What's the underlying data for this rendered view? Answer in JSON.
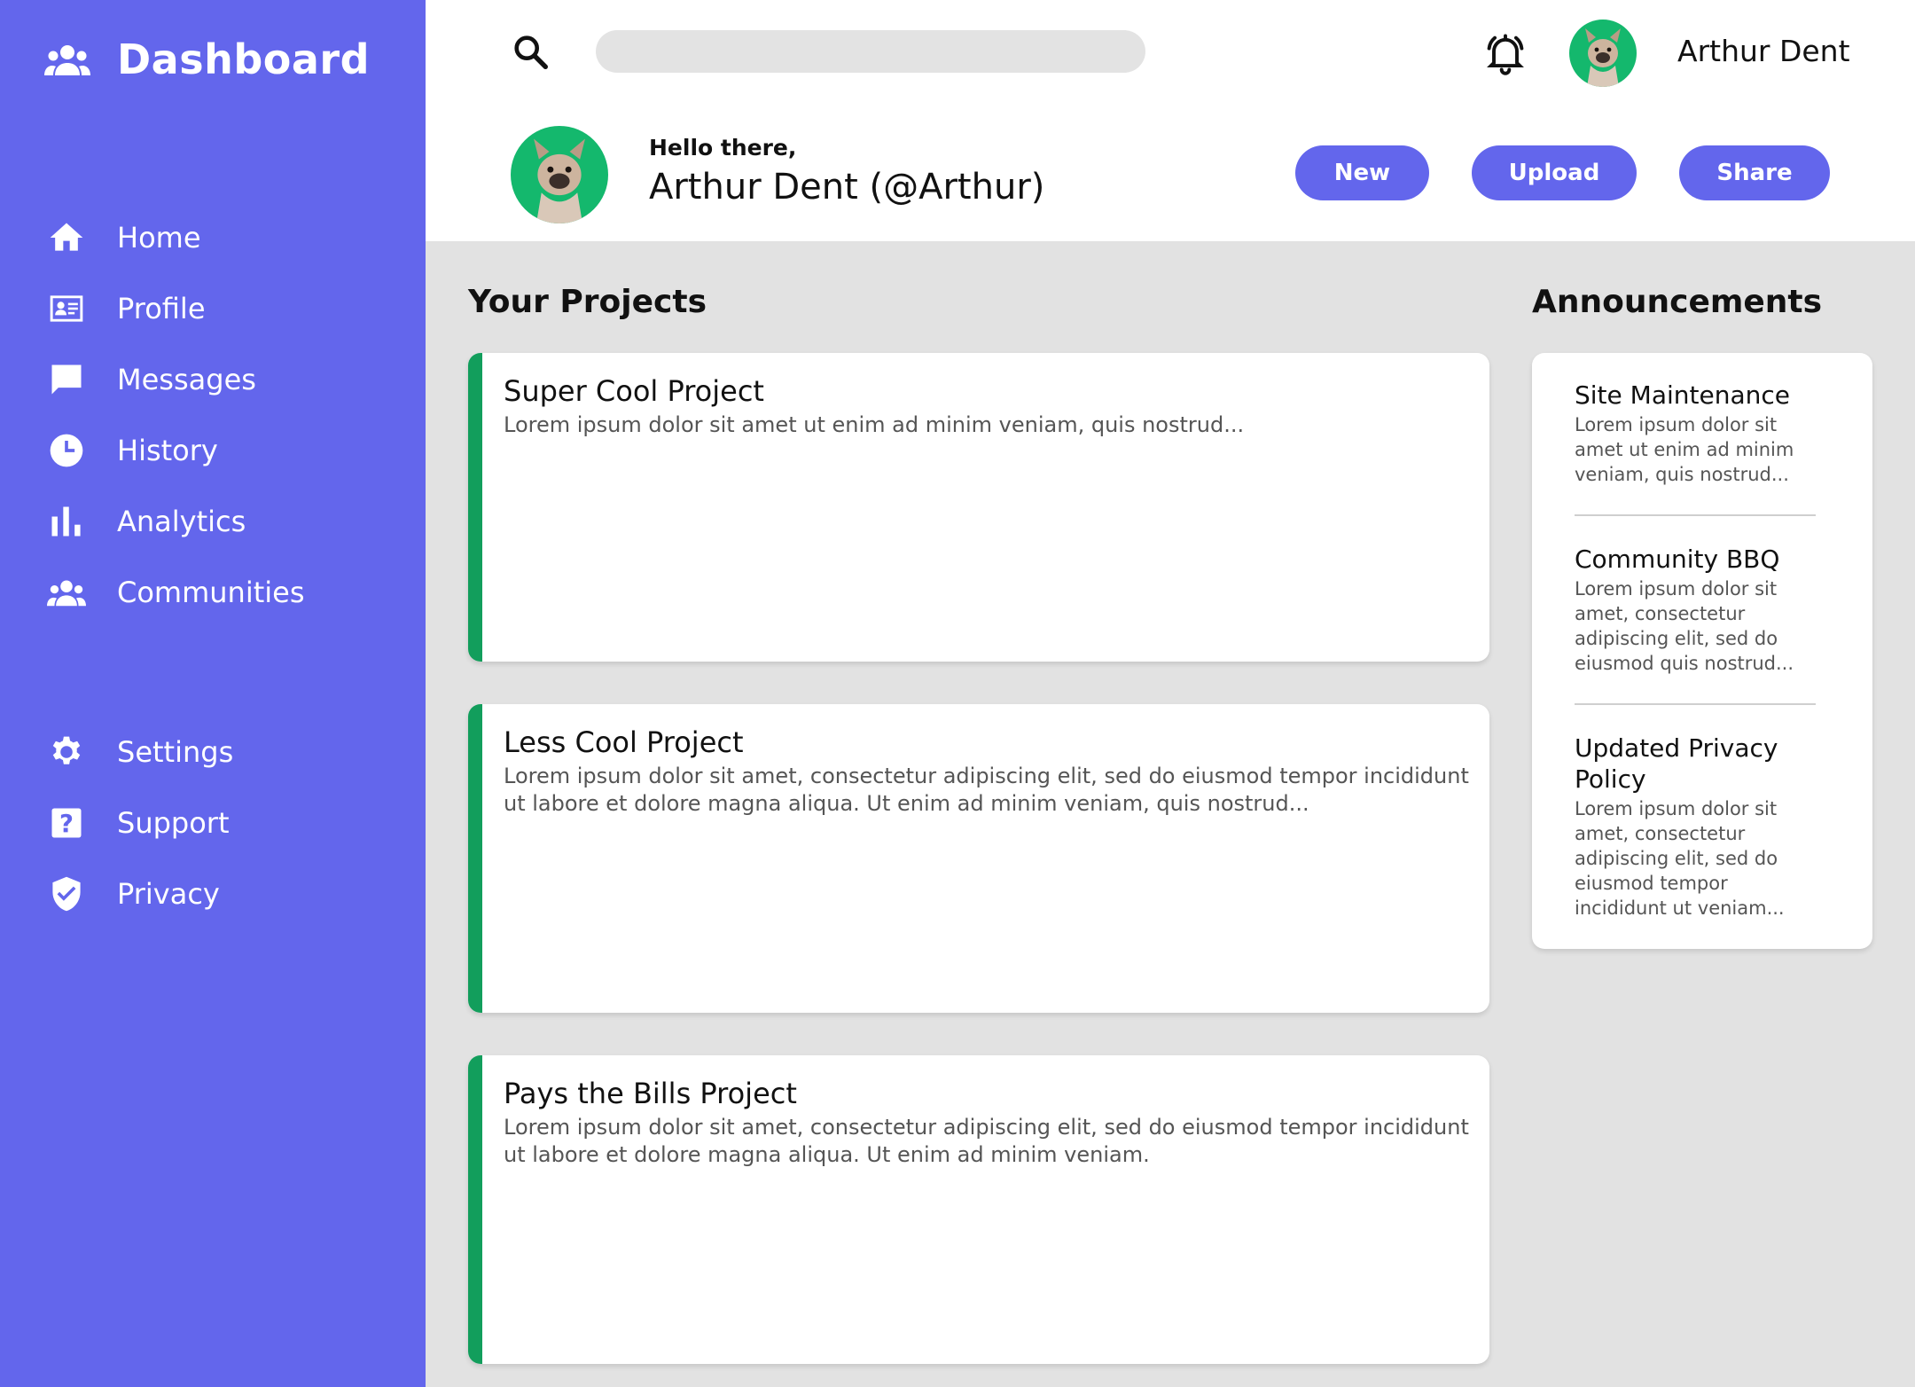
{
  "colors": {
    "accent": "#6366ec",
    "project_stripe": "#129e5c",
    "avatar_bg": "#14b86d",
    "page_bg": "#e2e2e2"
  },
  "sidebar": {
    "title": "Dashboard",
    "title_icon": "people-icon",
    "items": [
      {
        "label": "Home",
        "icon": "home-icon"
      },
      {
        "label": "Profile",
        "icon": "id-card-icon"
      },
      {
        "label": "Messages",
        "icon": "chat-bubble-icon"
      },
      {
        "label": "History",
        "icon": "clock-icon"
      },
      {
        "label": "Analytics",
        "icon": "bar-chart-icon"
      },
      {
        "label": "Communities",
        "icon": "people-icon"
      }
    ],
    "bottom_items": [
      {
        "label": "Settings",
        "icon": "gear-icon"
      },
      {
        "label": "Support",
        "icon": "help-icon"
      },
      {
        "label": "Privacy",
        "icon": "shield-check-icon"
      }
    ]
  },
  "header": {
    "search": {
      "placeholder": "",
      "value": ""
    },
    "username": "Arthur Dent",
    "greeting": "Hello there,",
    "fullname": "Arthur Dent (@Arthur)",
    "buttons": {
      "new": "New",
      "upload": "Upload",
      "share": "Share"
    }
  },
  "projects": {
    "title": "Your Projects",
    "items": [
      {
        "title": "Super Cool Project",
        "description": "Lorem ipsum dolor sit amet ut enim ad minim veniam, quis nostrud..."
      },
      {
        "title": "Less Cool Project",
        "description": "Lorem ipsum dolor sit amet, consectetur adipiscing elit, sed do eiusmod tempor incididunt ut labore et dolore magna aliqua. Ut enim ad minim veniam, quis nostrud..."
      },
      {
        "title": "Pays the Bills Project",
        "description": "Lorem ipsum dolor sit amet, consectetur adipiscing elit, sed do eiusmod tempor incididunt ut labore et dolore magna aliqua. Ut enim ad minim veniam."
      }
    ]
  },
  "announcements": {
    "title": "Announcements",
    "items": [
      {
        "title": "Site Maintenance",
        "description": "Lorem ipsum dolor sit amet ut enim ad minim veniam, quis nostrud..."
      },
      {
        "title": "Community BBQ",
        "description": "Lorem ipsum dolor sit amet, consectetur adipiscing elit, sed do eiusmod quis nostrud..."
      },
      {
        "title": "Updated Privacy Policy",
        "description": "Lorem ipsum dolor sit amet, consectetur adipiscing elit, sed do eiusmod tempor incididunt ut veniam..."
      }
    ]
  }
}
